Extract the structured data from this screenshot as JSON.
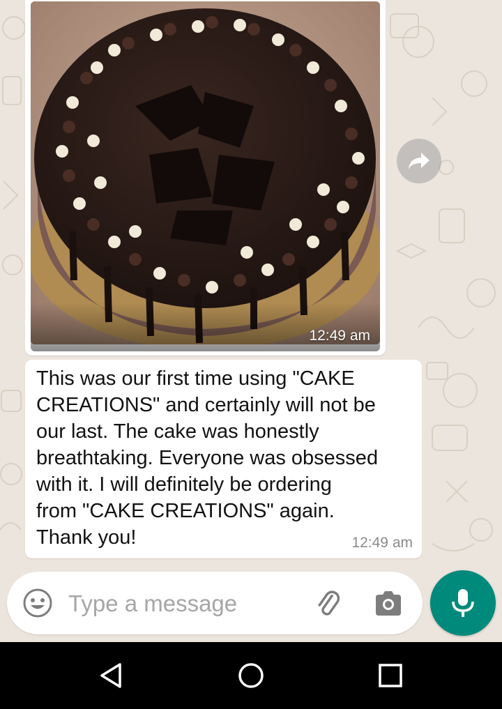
{
  "image_message": {
    "time": "12:49 am",
    "photo_alt": "chocolate-cake-photo"
  },
  "text_message": {
    "text": "This was our first time using \"CAKE\nCREATIONS\" and certainly will not be\nour last. The cake was honestly\nbreathtaking. Everyone was obsessed\nwith it. I will definitely be ordering\nfrom \"CAKE CREATIONS\" again.\nThank you!",
    "time": "12:49 am"
  },
  "composer": {
    "placeholder": "Type a message",
    "value": ""
  },
  "colors": {
    "chat_background": "#ece5dd",
    "bubble": "#ffffff",
    "accent": "#008a7c",
    "timestamp": "#8a8a8a"
  },
  "icons": {
    "forward": "forward-icon",
    "emoji": "emoji-icon",
    "attach": "paperclip-icon",
    "camera": "camera-icon",
    "mic": "microphone-icon",
    "nav_back": "back-triangle-icon",
    "nav_home": "home-circle-icon",
    "nav_recents": "recents-square-icon"
  }
}
